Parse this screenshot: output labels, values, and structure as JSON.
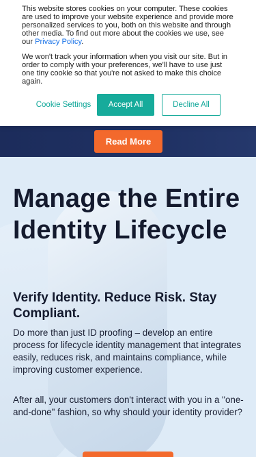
{
  "cookie_banner": {
    "text_1_pre": "This website stores cookies on your computer. These cookies are used to improve your website experience and provide more personalized services to you, both on this website and through other media. To find out more about the cookies we use, see our ",
    "privacy_link": "Privacy Policy",
    "text_1_post": ".",
    "text_2": "We won't track your information when you visit our site. But in order to comply with your preferences, we'll have to use just one tiny cookie so that you're not asked to make this choice again.",
    "settings_label": "Cookie Settings",
    "accept_label": "Accept All",
    "decline_label": "Decline All"
  },
  "promo": {
    "read_more_label": "Read More"
  },
  "hero": {
    "title": "Manage the Entire Identity Lifecycle",
    "subtitle": "Verify Identity. Reduce Risk. Stay Compliant.",
    "paragraph_1": "Do more than just ID proofing – develop an entire process for lifecycle identity management that integrates easily, reduces risk, and maintains compliance, while improving customer experience.",
    "paragraph_2": "After all, your customers don't interact with you in a \"one-and-done\" fashion, so why should your identity provider?"
  },
  "colors": {
    "accent_teal": "#17ab9b",
    "accent_orange": "#f3692c",
    "navy": "#1c2c5b",
    "hero_bg": "#deebf7",
    "link": "#1a73e8"
  }
}
